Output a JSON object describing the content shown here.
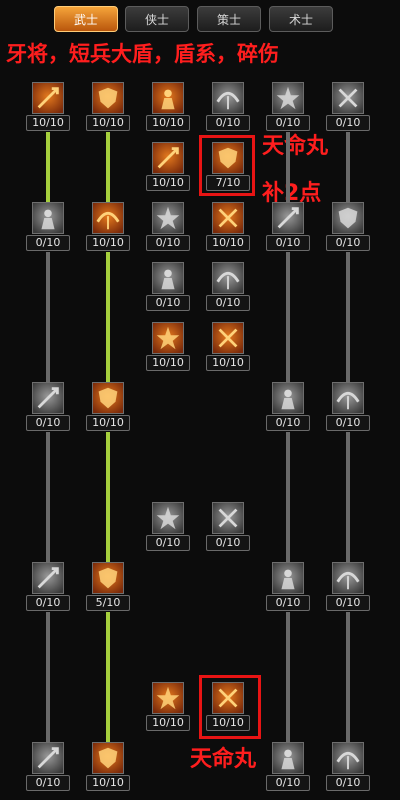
{
  "tabs": [
    {
      "label": "武士",
      "active": true
    },
    {
      "label": "侠士",
      "active": false
    },
    {
      "label": "策士",
      "active": false
    },
    {
      "label": "术士",
      "active": false
    }
  ],
  "annotations": {
    "title": "牙将，短兵大盾，盾系，碎伤",
    "tianmingwan_top": "天命丸",
    "bu2dian": "补2点",
    "tianmingwan_bottom": "天命丸"
  },
  "skills": [
    {
      "level": "10/10",
      "icon": "spear-icon",
      "active": true
    },
    {
      "level": "10/10",
      "icon": "slash-icon",
      "active": true
    },
    {
      "level": "10/10",
      "icon": "burst-icon",
      "active": true
    },
    {
      "level": "0/10",
      "icon": "fist-icon",
      "active": false
    },
    {
      "level": "0/10",
      "icon": "blade-icon",
      "active": false
    },
    {
      "level": "0/10",
      "icon": "axe-icon",
      "active": false
    },
    {
      "level": "10/10",
      "icon": "sword-swing-icon",
      "active": true
    },
    {
      "level": "7/10",
      "icon": "demon-icon",
      "active": true
    },
    {
      "level": "0/10",
      "icon": "shield-down-icon",
      "active": false
    },
    {
      "level": "10/10",
      "icon": "shield-blue-icon",
      "active": true
    },
    {
      "level": "0/10",
      "icon": "warrior-icon",
      "active": false
    },
    {
      "level": "10/10",
      "icon": "explosion-figure-icon",
      "active": true
    },
    {
      "level": "0/10",
      "icon": "shield-strike-icon",
      "active": false
    },
    {
      "level": "0/10",
      "icon": "armor-icon",
      "active": false
    },
    {
      "level": "0/10",
      "icon": "dash-icon",
      "active": false
    },
    {
      "level": "0/10",
      "icon": "punch-icon",
      "active": false
    },
    {
      "level": "10/10",
      "icon": "strike-icon",
      "active": true
    },
    {
      "level": "10/10",
      "icon": "whirl-icon",
      "active": true
    },
    {
      "level": "0/10",
      "icon": "shield-slash-icon",
      "active": false
    },
    {
      "level": "10/10",
      "icon": "shield-red-icon",
      "active": true
    },
    {
      "level": "0/10",
      "icon": "helm-icon",
      "active": false
    },
    {
      "level": "0/10",
      "icon": "cross-swords-icon",
      "active": false
    },
    {
      "level": "0/10",
      "icon": "stance-icon",
      "active": false
    },
    {
      "level": "0/10",
      "icon": "stand-icon",
      "active": false
    },
    {
      "level": "0/10",
      "icon": "shield-round-icon",
      "active": false
    },
    {
      "level": "5/10",
      "icon": "shield-swirl-icon",
      "active": true
    },
    {
      "level": "0/10",
      "icon": "knight-icon",
      "active": false
    },
    {
      "level": "0/10",
      "icon": "guard-icon",
      "active": false
    },
    {
      "level": "10/10",
      "icon": "rage-icon",
      "active": true
    },
    {
      "level": "10/10",
      "icon": "champion-icon",
      "active": true
    },
    {
      "level": "0/10",
      "icon": "shield-spin-icon",
      "active": false
    },
    {
      "level": "10/10",
      "icon": "shield-fire-icon",
      "active": true
    },
    {
      "level": "0/10",
      "icon": "sword-wave-icon",
      "active": false
    },
    {
      "level": "0/10",
      "icon": "crest-icon",
      "active": false
    }
  ],
  "colors": {
    "accent_tab": "#d8751c",
    "annotation_red": "#ff1e1e",
    "connector_green": "#a6cf3d",
    "connector_gray": "#6a6a6a"
  }
}
